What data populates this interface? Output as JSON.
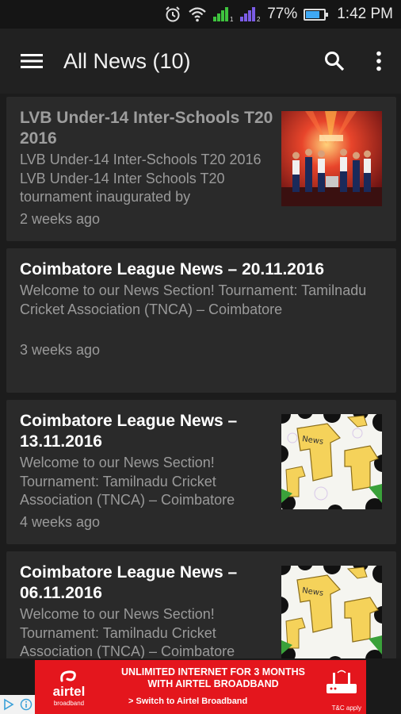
{
  "status_bar": {
    "battery": "77%",
    "time": "1:42 PM",
    "battery_level": 0.77,
    "icons": [
      "alarm-icon",
      "wifi-icon",
      "signal-sim1-icon",
      "signal-sim2-icon",
      "battery-icon"
    ]
  },
  "app_bar": {
    "title": "All News (10)",
    "icons": [
      "menu-icon",
      "search-icon",
      "overflow-menu-icon"
    ]
  },
  "news": [
    {
      "title": "LVB Under-14 Inter-Schools T20 2016",
      "excerpt": "LVB Under-14 Inter-Schools T20 2016   LVB Under-14 Inter Schools T20 tournament inaugurated by",
      "time": "2 weeks ago",
      "read": true,
      "thumbnail": "event-photo"
    },
    {
      "title": "Coimbatore League News – 20.11.2016",
      "excerpt": "Welcome to our News Section! Tournament: Tamilnadu Cricket Association (TNCA) – Coimbatore",
      "time": "3 weeks ago",
      "read": false,
      "thumbnail": null
    },
    {
      "title": "Coimbatore League News – 13.11.2016",
      "excerpt": "Welcome to our News Section! Tournament: Tamilnadu Cricket Association (TNCA) – Coimbatore",
      "time": "4 weeks ago",
      "read": false,
      "thumbnail": "news-jersey-graphic"
    },
    {
      "title": "Coimbatore League News – 06.11.2016",
      "excerpt": "Welcome to our News Section! Tournament: Tamilnadu Cricket Association (TNCA) – Coimbatore",
      "time": "",
      "read": false,
      "thumbnail": "news-jersey-graphic"
    }
  ],
  "ad": {
    "brand": "airtel",
    "brand_sub": "broadband",
    "line1": "UNLIMITED INTERNET FOR 3 MONTHS",
    "line2": "WITH AIRTEL BROADBAND",
    "cta": "> Switch to Airtel Broadband",
    "tc": "T&C apply",
    "background_color": "#e4161d"
  }
}
